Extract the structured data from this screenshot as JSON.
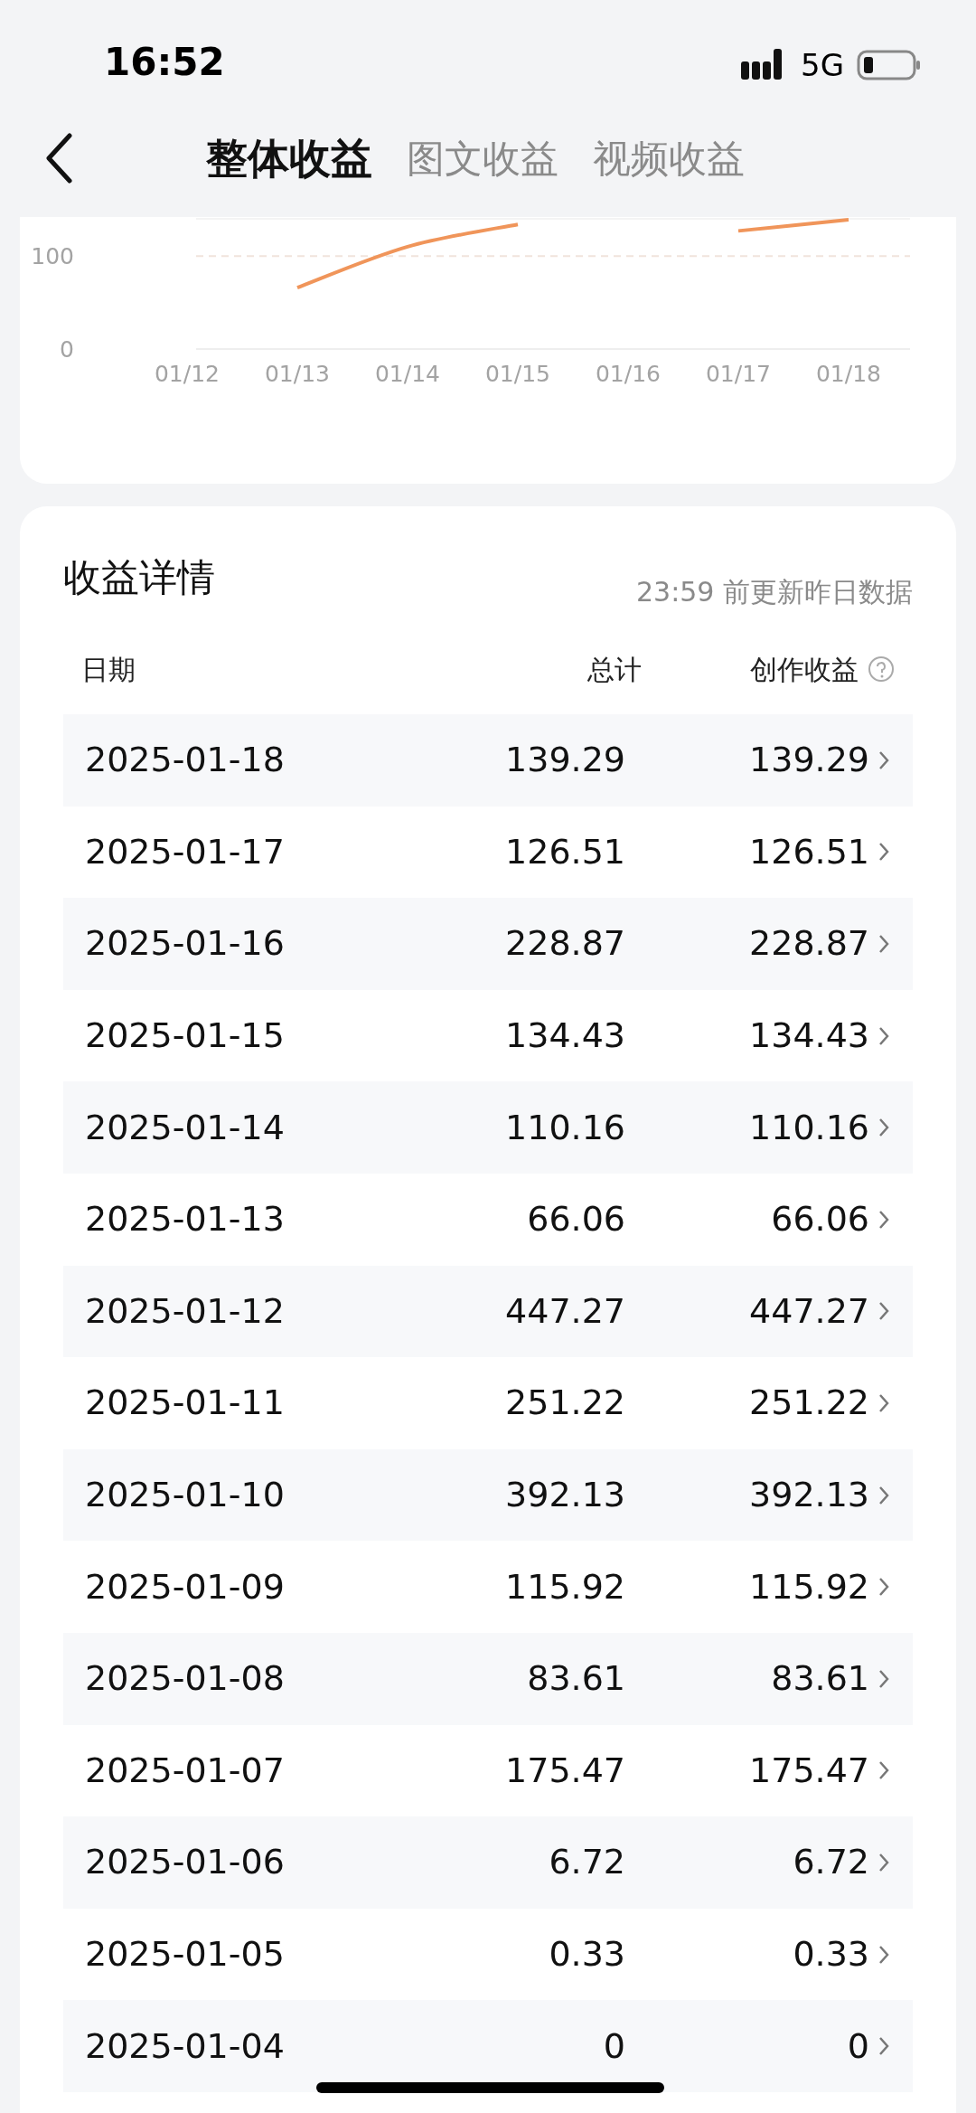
{
  "status_bar": {
    "time": "16:52",
    "network": "5G"
  },
  "nav": {
    "tabs": [
      {
        "label": "整体收益",
        "selected": true
      },
      {
        "label": "图文收益",
        "selected": false
      },
      {
        "label": "视频收益",
        "selected": false
      }
    ]
  },
  "chart": {
    "chart_data": {
      "type": "line",
      "categories": [
        "01/12",
        "01/13",
        "01/14",
        "01/15",
        "01/16",
        "01/17",
        "01/18"
      ],
      "series": [
        {
          "color": "#f0955a",
          "values": [
            null,
            66,
            110,
            134,
            null,
            127,
            139
          ]
        }
      ],
      "ylim": [
        0,
        140
      ],
      "yticks": [
        0,
        100
      ]
    }
  },
  "details": {
    "title": "收益详情",
    "update_note": "23:59 前更新昨日数据",
    "columns": [
      "日期",
      "总计",
      "创作收益"
    ],
    "rows": [
      {
        "date": "2025-01-18",
        "total": "139.29",
        "creation": "139.29"
      },
      {
        "date": "2025-01-17",
        "total": "126.51",
        "creation": "126.51"
      },
      {
        "date": "2025-01-16",
        "total": "228.87",
        "creation": "228.87"
      },
      {
        "date": "2025-01-15",
        "total": "134.43",
        "creation": "134.43"
      },
      {
        "date": "2025-01-14",
        "total": "110.16",
        "creation": "110.16"
      },
      {
        "date": "2025-01-13",
        "total": "66.06",
        "creation": "66.06"
      },
      {
        "date": "2025-01-12",
        "total": "447.27",
        "creation": "447.27"
      },
      {
        "date": "2025-01-11",
        "total": "251.22",
        "creation": "251.22"
      },
      {
        "date": "2025-01-10",
        "total": "392.13",
        "creation": "392.13"
      },
      {
        "date": "2025-01-09",
        "total": "115.92",
        "creation": "115.92"
      },
      {
        "date": "2025-01-08",
        "total": "83.61",
        "creation": "83.61"
      },
      {
        "date": "2025-01-07",
        "total": "175.47",
        "creation": "175.47"
      },
      {
        "date": "2025-01-06",
        "total": "6.72",
        "creation": "6.72"
      },
      {
        "date": "2025-01-05",
        "total": "0.33",
        "creation": "0.33"
      },
      {
        "date": "2025-01-04",
        "total": "0",
        "creation": "0"
      }
    ]
  }
}
